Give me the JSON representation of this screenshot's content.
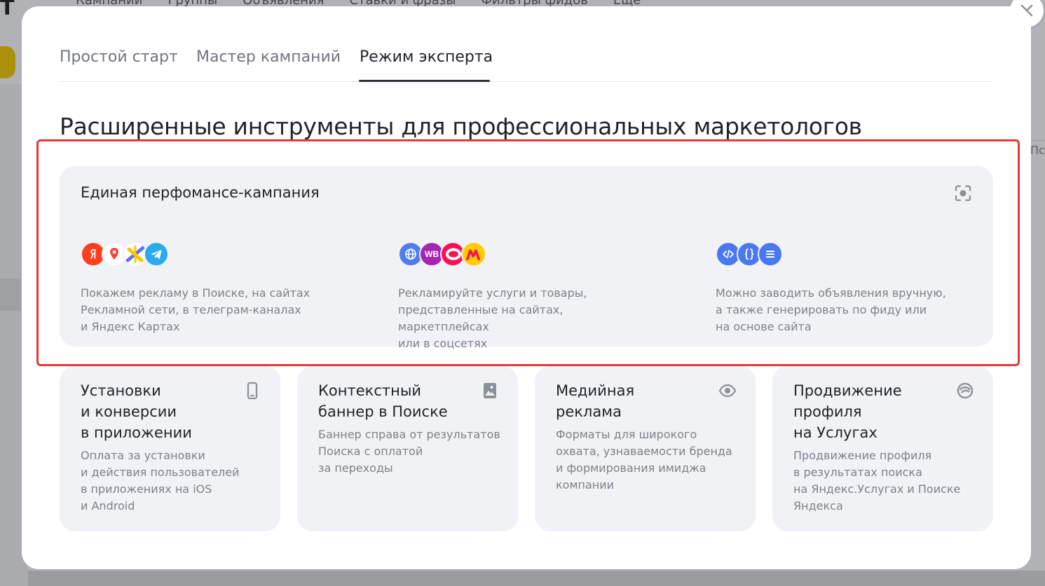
{
  "background": {
    "logo_letter": "T",
    "tabs": [
      "Кампании",
      "Группы",
      "Объявления",
      "Ставки и фразы",
      "Фильтры фидов",
      "Еще"
    ],
    "right_text": "Пс"
  },
  "modal": {
    "close_label": "×",
    "tabs": [
      {
        "label": "Простой старт",
        "active": false
      },
      {
        "label": "Мастер кампаний",
        "active": false
      },
      {
        "label": "Режим эксперта",
        "active": true
      }
    ],
    "title": "Расширенные инструменты для профессиональных маркетологов",
    "highlight_color": "#e53935",
    "featured": {
      "title": "Единая перфомансe-кампания",
      "corner_icon": "focus-icon",
      "features": [
        {
          "icons": [
            "yandex-icon",
            "maps-pin-icon",
            "partner-network-icon",
            "telegram-icon"
          ],
          "text": "Покажем рекламу в Поиске, на сайтах\nРекламной сети, в телеграм-каналах\nи Яндекс Картах"
        },
        {
          "icons": [
            "globe-icon",
            "wildberries-icon",
            "ozon-icon",
            "yandex-market-icon"
          ],
          "icon_text": {
            "wb": "WB"
          },
          "text": "Рекламируйте услуги и товары,\nпредставленные на сайтах, маркетплейсах\nили в соцсетях"
        },
        {
          "icons": [
            "code-icon",
            "braces-icon",
            "feed-icon"
          ],
          "text": "Можно заводить объявления вручную,\nа также генерировать по фиду или\nна основе сайта"
        }
      ]
    },
    "cards": [
      {
        "title": "Установки\nи конверсии\nв приложении",
        "desc": "Оплата за установки\nи действия пользователей\nв приложениях на iOS\nи Android",
        "icon": "phone-icon"
      },
      {
        "title": "Контекстный\nбаннер в Поиске",
        "desc": "Баннер справа от результатов\nПоиска с оплатой\nза переходы",
        "icon": "image-icon"
      },
      {
        "title": "Медийная\nреклама",
        "desc": "Форматы для широкого\nохвата, узнаваемости бренда\nи формирования имиджа\nкомпании",
        "icon": "eye-icon"
      },
      {
        "title": "Продвижение\nпрофиля\nна Услугах",
        "desc": "Продвижение профиля\nв результатах поиска\nна Яндекс.Услугах и Поиске\nЯндекса",
        "icon": "services-icon"
      }
    ],
    "accent_colors": {
      "yandex": "#fc3f1d",
      "telegram": "#2aabee",
      "globe": "#4f7df0",
      "wildberries": "#a626b4",
      "ozon": "#f91155",
      "market": "#ffcc00",
      "tools": "#4978f2"
    }
  }
}
